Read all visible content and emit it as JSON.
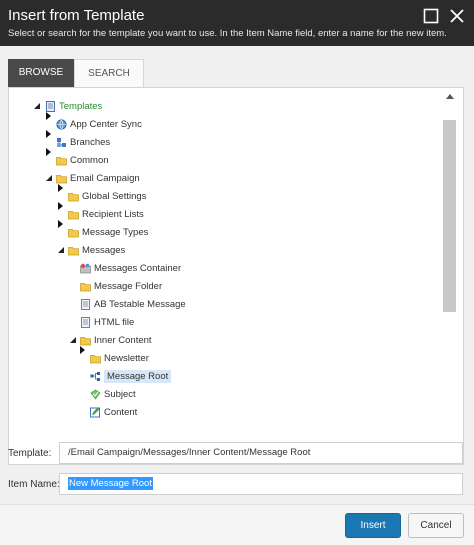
{
  "dialog": {
    "title": "Insert from Template",
    "subtitle": "Select or search for the template you want to use. In the Item Name field, enter a name for the new item."
  },
  "tabs": [
    {
      "label": "BROWSE",
      "active": true
    },
    {
      "label": "SEARCH",
      "active": false
    }
  ],
  "tree": [
    {
      "label": "Templates",
      "icon": "templates-icon",
      "state": "expanded"
    },
    {
      "label": "App Center Sync",
      "icon": "globe-icon",
      "state": "collapsed"
    },
    {
      "label": "Branches",
      "icon": "branch-icon",
      "state": "collapsed"
    },
    {
      "label": "Common",
      "icon": "folder-icon",
      "state": "collapsed"
    },
    {
      "label": "Email Campaign",
      "icon": "folder-icon",
      "state": "expanded"
    },
    {
      "label": "Global Settings",
      "icon": "folder-icon",
      "state": "collapsed"
    },
    {
      "label": "Recipient Lists",
      "icon": "folder-icon",
      "state": "collapsed"
    },
    {
      "label": "Message Types",
      "icon": "folder-icon",
      "state": "collapsed"
    },
    {
      "label": "Messages",
      "icon": "folder-icon",
      "state": "expanded"
    },
    {
      "label": "Messages Container",
      "icon": "messages-container-icon",
      "state": "leaf"
    },
    {
      "label": "Message Folder",
      "icon": "folder-icon",
      "state": "leaf"
    },
    {
      "label": "AB Testable Message",
      "icon": "document-icon",
      "state": "leaf"
    },
    {
      "label": "HTML file",
      "icon": "document-icon",
      "state": "leaf"
    },
    {
      "label": "Inner Content",
      "icon": "folder-icon",
      "state": "expanded"
    },
    {
      "label": "Newsletter",
      "icon": "folder-icon",
      "state": "collapsed"
    },
    {
      "label": "Message Root",
      "icon": "message-root-icon",
      "state": "selected"
    },
    {
      "label": "Subject",
      "icon": "subject-icon",
      "state": "leaf"
    },
    {
      "label": "Content",
      "icon": "content-icon",
      "state": "leaf"
    }
  ],
  "fields": {
    "template_label": "Template:",
    "template_value": "/Email Campaign/Messages/Inner Content/Message Root",
    "item_name_label": "Item Name:",
    "item_name_value": "New Message Root"
  },
  "buttons": {
    "insert": "Insert",
    "cancel": "Cancel"
  },
  "colors": {
    "titlebar": "#2b2b2b",
    "active_tab": "#4a4a4a",
    "primary_button": "#1b78b2",
    "selection": "#3399ff",
    "folder": "#f2c94c"
  }
}
